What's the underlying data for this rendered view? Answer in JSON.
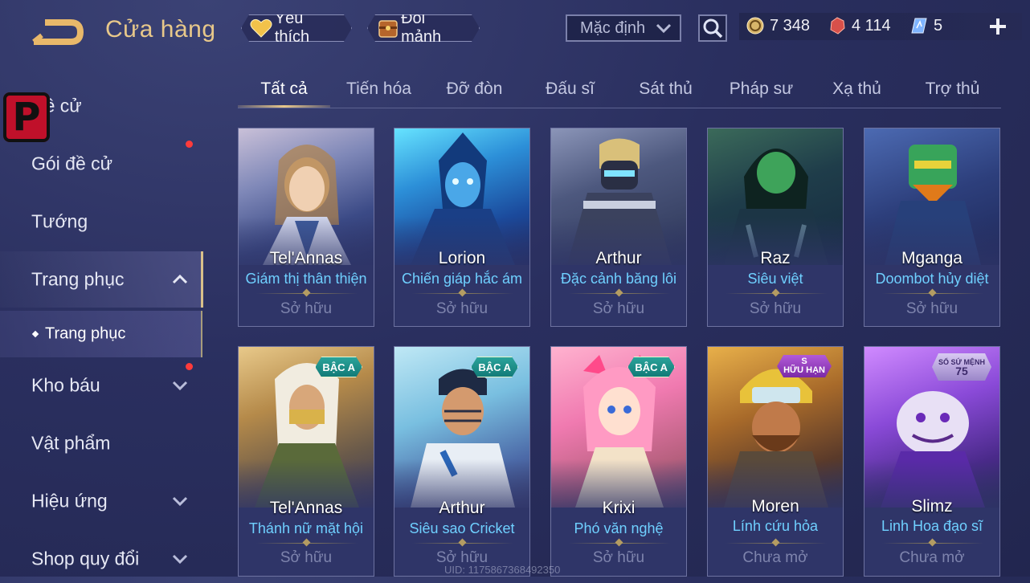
{
  "header": {
    "title": "Cửa hàng",
    "favorite_label": "Yêu thích",
    "shard_label": "Đổi mảnh",
    "sort_value": "Mặc định",
    "currency": {
      "gold": "7 348",
      "gem": "4 114",
      "ticket": "5"
    }
  },
  "sidebar": {
    "items": [
      {
        "label": "Đề cử"
      },
      {
        "label": "Gói đề cử"
      },
      {
        "label": "Tướng"
      },
      {
        "label": "Trang phục"
      },
      {
        "label": "Kho báu"
      },
      {
        "label": "Vật phẩm"
      },
      {
        "label": "Hiệu ứng"
      },
      {
        "label": "Shop quy đổi"
      }
    ],
    "sub_item": "Trang phục"
  },
  "tabs": [
    "Tất cả",
    "Tiến hóa",
    "Đỡ đòn",
    "Đấu sĩ",
    "Sát thủ",
    "Pháp sư",
    "Xạ thủ",
    "Trợ thủ"
  ],
  "cards": [
    {
      "hero": "Tel'Annas",
      "skin": "Giám thị thân thiện",
      "status": "Sở hữu",
      "badge": ""
    },
    {
      "hero": "Lorion",
      "skin": "Chiến giáp hắc ám",
      "status": "Sở hữu",
      "badge": ""
    },
    {
      "hero": "Arthur",
      "skin": "Đặc cảnh băng lôi",
      "status": "Sở hữu",
      "badge": ""
    },
    {
      "hero": "Raz",
      "skin": "Siêu việt",
      "status": "Sở hữu",
      "badge": ""
    },
    {
      "hero": "Mganga",
      "skin": "Doombot hủy diệt",
      "status": "Sở hữu",
      "badge": ""
    },
    {
      "hero": "Tel'Annas",
      "skin": "Thánh nữ mặt hội",
      "status": "Sở hữu",
      "badge": "BẬC A"
    },
    {
      "hero": "Arthur",
      "skin": "Siêu sao Cricket",
      "status": "Sở hữu",
      "badge": "BẬC A"
    },
    {
      "hero": "Krixi",
      "skin": "Phó văn nghệ",
      "status": "Sở hữu",
      "badge": "BẬC A"
    },
    {
      "hero": "Moren",
      "skin": "Lính cứu hỏa",
      "status": "Chưa mở",
      "badge": "S",
      "badge_sub": "HỮU HẠN"
    },
    {
      "hero": "Slimz",
      "skin": "Linh Hoa đạo sĩ",
      "status": "Chưa mở",
      "badge": "SỔ SỨ MỆNH",
      "badge_sub": "75"
    }
  ],
  "uid": "UID: 1175867368492350",
  "colors": {
    "accent_gold": "#e8c88a",
    "skin_name": "#6fd0ff",
    "badge_red_dot": "#ff3b3b",
    "background": "#2a2f5f"
  },
  "icons": [
    "back-arrow-icon",
    "heart-icon",
    "chest-icon",
    "chevron-down-icon",
    "search-icon",
    "gold-coin-icon",
    "red-gem-icon",
    "ticket-icon",
    "plus-icon",
    "chevron-up-icon"
  ]
}
